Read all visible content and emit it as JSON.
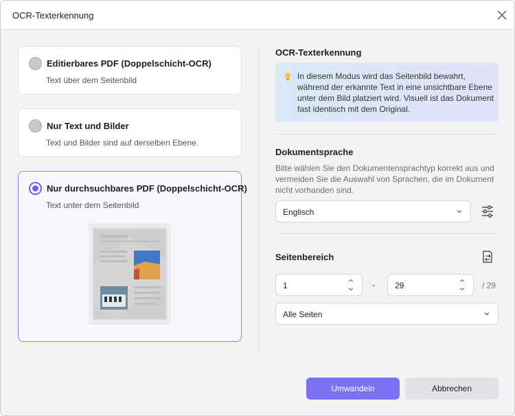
{
  "dialog": {
    "title": "OCR-Texterkennung"
  },
  "options": [
    {
      "title": "Editierbares PDF (Doppelschicht-OCR)",
      "subtitle": "Text über dem Seitenbild",
      "selected": false
    },
    {
      "title": "Nur Text und Bilder",
      "subtitle": "Text und Bilder sind auf derselben Ebene.",
      "selected": false
    },
    {
      "title": "Nur durchsuchbares PDF (Doppelschicht-OCR)",
      "subtitle": "Text unter dem Seitenbild",
      "selected": true
    }
  ],
  "right": {
    "ocr_title": "OCR-Texterkennung",
    "info_text": "In diesem Modus wird das Seitenbild bewahrt, während der erkannte Text in eine unsichtbare Ebene unter dem Bild platziert wird. Visuell ist das Dokument fast identisch mit dem Original.",
    "language_title": "Dokumentsprache",
    "language_desc": "Bitte wählen Sie den Dokumentensprachtyp korrekt aus und vermeiden Sie die Auswahl von Sprachen, die im Dokument nicht vorhanden sind.",
    "language_value": "Englisch",
    "range_title": "Seitenbereich",
    "range_from": "1",
    "range_dash": "-",
    "range_to": "29",
    "range_total": "/ 29",
    "pages_value": "Alle Seiten"
  },
  "buttons": {
    "convert": "Umwandeln",
    "cancel": "Abbrechen"
  },
  "colors": {
    "accent": "#7a72f3",
    "selected_border": "#8b84f0",
    "background": "#f3f2f4"
  },
  "icons": [
    "close-icon",
    "lightbulb-icon",
    "chevron-down-icon",
    "sliders-icon",
    "page-range-icon",
    "spin-up-icon",
    "spin-down-icon"
  ]
}
